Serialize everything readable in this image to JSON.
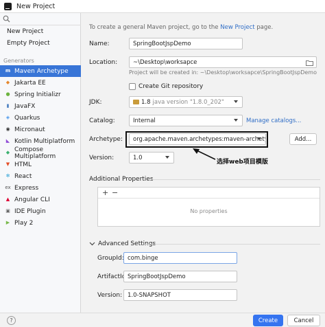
{
  "window": {
    "title": "New Project"
  },
  "sidebar": {
    "top_items": [
      "New Project",
      "Empty Project"
    ],
    "section": "Generators",
    "generators": [
      {
        "label": "Maven Archetype",
        "icon": "maven-icon",
        "selected": true
      },
      {
        "label": "Jakarta EE",
        "icon": "jakarta-icon"
      },
      {
        "label": "Spring Initializr",
        "icon": "spring-icon"
      },
      {
        "label": "JavaFX",
        "icon": "javafx-icon"
      },
      {
        "label": "Quarkus",
        "icon": "quarkus-icon"
      },
      {
        "label": "Micronaut",
        "icon": "micronaut-icon"
      },
      {
        "label": "Kotlin Multiplatform",
        "icon": "kotlin-icon"
      },
      {
        "label": "Compose Multiplatform",
        "icon": "compose-icon"
      },
      {
        "label": "HTML",
        "icon": "html-icon"
      },
      {
        "label": "React",
        "icon": "react-icon"
      },
      {
        "label": "Express",
        "icon": "express-icon"
      },
      {
        "label": "Angular CLI",
        "icon": "angular-icon"
      },
      {
        "label": "IDE Plugin",
        "icon": "plugin-icon"
      },
      {
        "label": "Play 2",
        "icon": "play-icon"
      }
    ]
  },
  "main": {
    "intro_prefix": "To create a general Maven project, go to the",
    "intro_link": "New Project",
    "intro_suffix": "page.",
    "name_label": "Name:",
    "name_value": "SpringBootJspDemo",
    "location_label": "Location:",
    "location_value": "~\\Desktop\\worksapce",
    "location_hint": "Project will be created in: ~\\Desktop\\worksapce\\SpringBootJspDemo",
    "git_label": "Create Git repository",
    "jdk_label": "JDK:",
    "jdk_version": "1.8",
    "jdk_detail": "java version \"1.8.0_202\"",
    "catalog_label": "Catalog:",
    "catalog_value": "Internal",
    "manage_catalogs": "Manage catalogs...",
    "archetype_label": "Archetype:",
    "archetype_value": "org.apache.maven.archetypes:maven-archetype-webapp",
    "add_button": "Add...",
    "annotation": "选择web项目模版",
    "version_label": "Version:",
    "version_value": "1.0",
    "additional_properties": "Additional Properties",
    "add_prop": "+",
    "remove_prop": "−",
    "no_properties": "No properties",
    "advanced_settings": "Advanced Settings",
    "groupid_label": "GroupId:",
    "groupid_value": "com.binge",
    "artifactid_label": "ArtifactId:",
    "artifactid_value": "SpringBootJspDemo",
    "version2_label": "Version:",
    "version2_value": "1.0-SNAPSHOT"
  },
  "footer": {
    "help": "?",
    "create": "Create",
    "cancel": "Cancel"
  }
}
